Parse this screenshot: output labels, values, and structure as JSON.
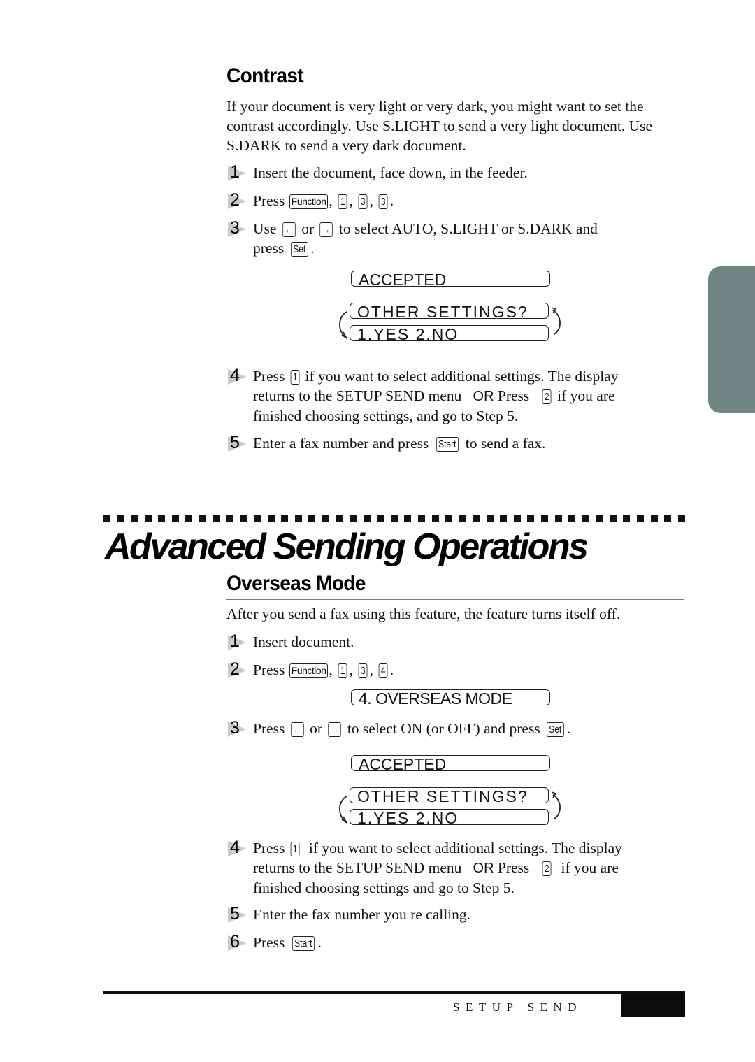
{
  "contrast": {
    "title": "Contrast",
    "intro": "If your document is very light or very dark, you might want to set the contrast accordingly. Use S.LIGHT to send a very light document. Use S.DARK to send a very dark document.",
    "steps": [
      {
        "num": "1",
        "text": "Insert the document, face down, in the feeder."
      },
      {
        "num": "2",
        "pre": "Press",
        "keys": [
          "Function",
          "1",
          "3",
          "3"
        ]
      },
      {
        "num": "3",
        "pre": "Use",
        "key_left": "←",
        "mid": "or",
        "key_right": "→",
        "post": "to select AUTO, S.LIGHT or S.DARK and",
        "line2_pre": "press",
        "key_set": "Set"
      },
      {
        "num": "4",
        "pre": "Press",
        "key1": "1",
        "text1": "if you want to select additional settings. The display",
        "text2a": "returns to the SETUP SEND menu",
        "or": "OR",
        "text2b": "Press",
        "key2": "2",
        "text2c": "if you are",
        "text3": "finished choosing settings, and go to Step 5."
      },
      {
        "num": "5",
        "pre": "Enter a fax number and press",
        "key": "Start",
        "post": "to send a fax."
      }
    ],
    "lcd": {
      "accepted": "ACCEPTED",
      "other_settings": "OTHER SETTINGS?",
      "yes_no": "1.YES 2.NO"
    }
  },
  "section": {
    "title": "Advanced Sending Operations"
  },
  "overseas": {
    "title": "Overseas Mode",
    "intro": "After you send a fax using this feature, the feature turns itself off.",
    "steps": [
      {
        "num": "1",
        "text": "Insert document."
      },
      {
        "num": "2",
        "pre": "Press",
        "keys": [
          "Function",
          "1",
          "3",
          "4"
        ]
      },
      {
        "num": "3",
        "pre": "Press",
        "key_left": "←",
        "mid": "or",
        "key_right": "→",
        "post": "to select ON (or OFF) and press",
        "key_set": "Set"
      },
      {
        "num": "4",
        "pre": "Press",
        "key1": "1",
        "text1": "if you want to select additional settings. The display",
        "text2a": "returns to the SETUP SEND menu",
        "or": "OR",
        "text2b": "Press",
        "key2": "2",
        "text2c": "if you are",
        "text3": "finished choosing settings and go to Step 5."
      },
      {
        "num": "5",
        "text": "Enter the fax number you re calling."
      },
      {
        "num": "6",
        "pre": "Press",
        "key": "Start"
      }
    ],
    "lcd": {
      "mode": "4. OVERSEAS  MODE",
      "accepted": "ACCEPTED",
      "other_settings": "OTHER SETTINGS?",
      "yes_no": "1.YES 2.NO"
    }
  },
  "footer": {
    "running_title": "SETUP SEND"
  },
  "colors": {
    "side_tab": "#6e8581",
    "step_marker": "#c9c9c9"
  }
}
